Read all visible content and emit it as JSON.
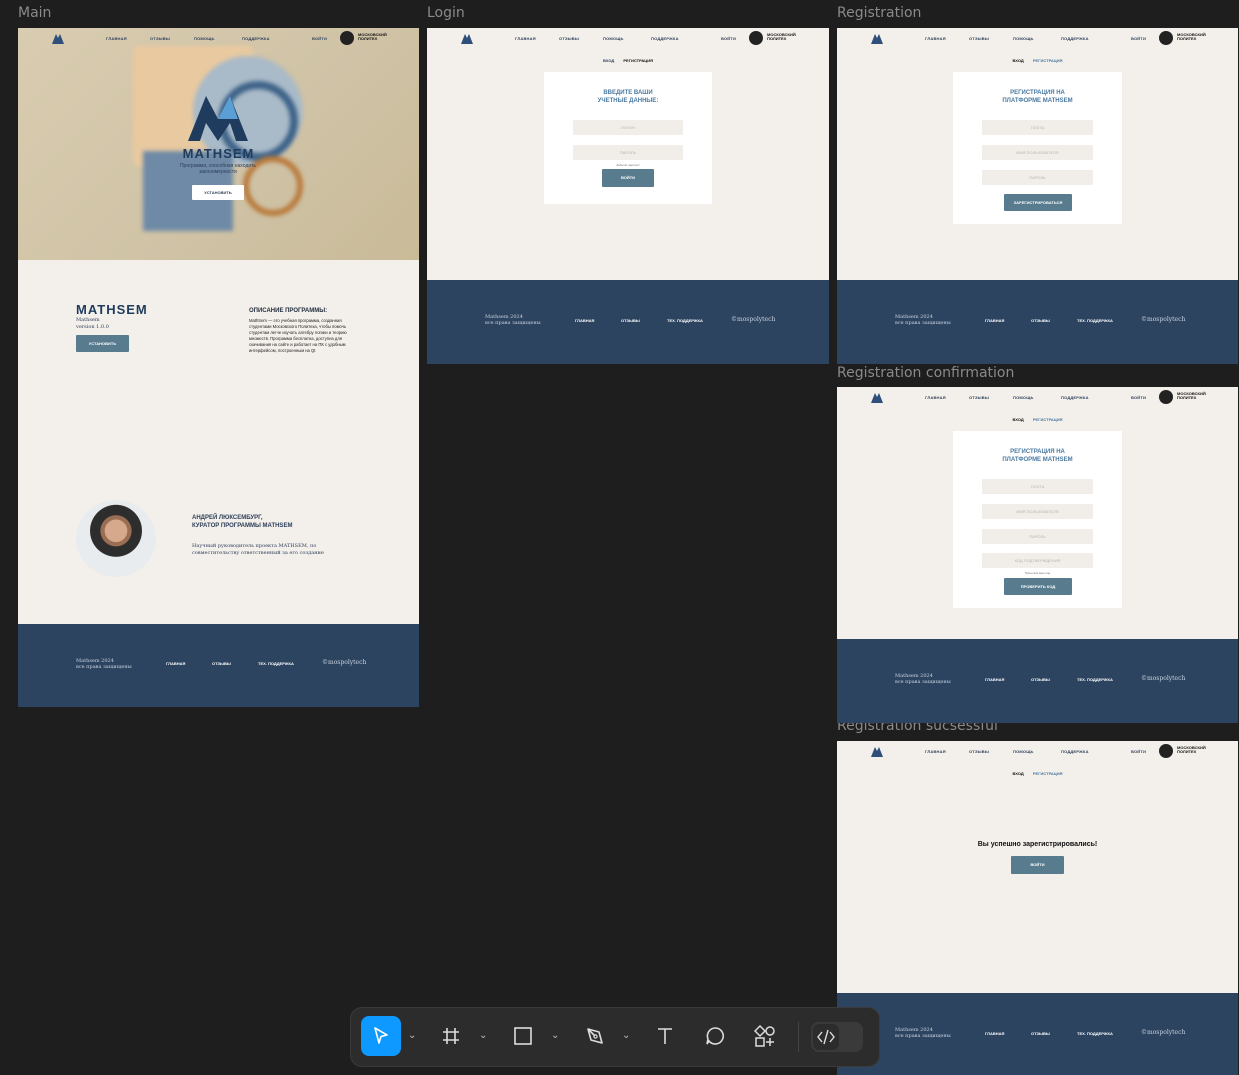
{
  "nav": {
    "items": [
      "ГЛАВНАЯ",
      "ОТЗЫВЫ",
      "ПОМОЩЬ",
      "ПОДДЕРЖКА",
      "ВОЙТИ"
    ],
    "brand": "МОСКОВСКИЙ ПОЛИТЕХ"
  },
  "labels": {
    "main": "Main",
    "login": "Login",
    "registration": "Registration",
    "confirm": "Registration confirmation",
    "success": "Registration sucsessful"
  },
  "tabs": {
    "login": "ВХОД",
    "register": "РЕГИСТРАЦИЯ"
  },
  "main": {
    "hero_logo": "MATHSEM",
    "hero_tagline": "Программа, способная находить закономерности",
    "hero_button": "УСТАНОВИТЬ",
    "logo": "MATHSEM",
    "product_name": "Mathsem",
    "version": "version 1.0.0",
    "install_button": "УСТАНОВИТЬ",
    "desc_title": "ОПИСАНИЕ ПРОГРАММЫ:",
    "desc_text": "MathSem — это учебная программа, созданная студентами Московского Политеха, чтобы помочь студентам легче изучать алгебру логики и теорию множеств. Программа бесплатна, доступна для скачивания на сайте и работает на ПК с удобным интерфейсом, построенным на Qt",
    "curator_name": "АНДРЕЙ ЛЮКСЕМБУРГ,",
    "curator_role": "КУРАТОР ПРОГРАММЫ MATHSEM",
    "curator_text": "Научный руководитель проекта MATHSEM, по совместительству ответственный за его создание"
  },
  "login": {
    "title": "ВВЕДИТЕ ВАШИ УЧЕТНЫЕ ДАННЫЕ:",
    "login_placeholder": "ЛОГИН",
    "password_placeholder": "ПАРОЛЬ",
    "forgot": "Забыли пароль?",
    "button": "ВОЙТИ"
  },
  "registration": {
    "title": "РЕГИСТРАЦИЯ НА ПЛАТФОРМЕ MATHSEM",
    "email_placeholder": "ПОЧТА",
    "username_placeholder": "ИМЯ ПОЛЬЗОВАТЕЛЯ",
    "password_placeholder": "ПАРОЛЬ",
    "button": "ЗАРЕГИСТРИРОВАТЬСЯ"
  },
  "confirm": {
    "title": "РЕГИСТРАЦИЯ НА ПЛАТФОРМЕ MATHSEM",
    "email_placeholder": "ПОЧТА",
    "username_placeholder": "ИМЯ ПОЛЬЗОВАТЕЛЯ",
    "password_placeholder": "ПАРОЛЬ",
    "code_placeholder": "КОД ПОДТВЕРЖДЕНИЯ",
    "hint": "Пришлем ваш код",
    "button": "ПРОВЕРИТЬ КОД"
  },
  "success": {
    "message": "Вы успешно зарегистрировались!",
    "button": "ВОЙТИ"
  },
  "footer": {
    "line1": "Mathsem 2024",
    "line2": "все права защищены",
    "links": [
      "ГЛАВНАЯ",
      "ОТЗЫВЫ",
      "ТЕХ. ПОДДЕРЖКА"
    ],
    "copyright": "©mospolytech"
  },
  "toolbar": {
    "tools": [
      "move-tool",
      "frame-tool",
      "rectangle-tool",
      "pen-tool",
      "text-tool",
      "comment-tool",
      "assets-tool",
      "dev-mode-toggle"
    ],
    "accent": "#0d99ff"
  }
}
